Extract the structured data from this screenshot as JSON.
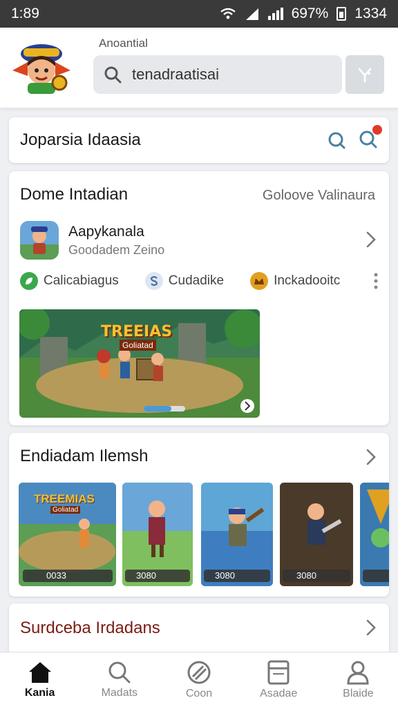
{
  "status": {
    "time": "1:89",
    "battery": "697%",
    "clock": "1334"
  },
  "header": {
    "label": "Anoantial",
    "search_value": "tenadraatisai"
  },
  "bar": {
    "title": "Joparsia Idaasia"
  },
  "featured": {
    "title": "Dome Intadian",
    "right_label": "Goloove Valinaura",
    "app": {
      "name": "Aapykanala",
      "subtitle": "Goodadem Zeino"
    },
    "tags": [
      {
        "label": "Calicabiagus",
        "icon": "leaf-icon",
        "color": "#3aa84a"
      },
      {
        "label": "Cudadike",
        "icon": "s-icon",
        "color": "#6a8fc0"
      },
      {
        "label": "Inckadooitc",
        "icon": "crown-icon",
        "color": "#e0a020"
      }
    ],
    "banner": {
      "title": "TREEIAS",
      "subtitle": "Goliatad"
    }
  },
  "section2": {
    "title": "Endiadam Ilemsh",
    "thumbs": [
      {
        "title": "TREEMIAS",
        "subtitle": "Goliatad",
        "caption": "0033",
        "bg": "#5b9e54"
      },
      {
        "title": "",
        "subtitle": "",
        "caption": "3080",
        "bg": "#7fbf5f"
      },
      {
        "title": "",
        "subtitle": "",
        "caption": "3080",
        "bg": "#5ea6d6"
      },
      {
        "title": "",
        "subtitle": "",
        "caption": "3080",
        "bg": "#6a4d3a"
      },
      {
        "title": "",
        "subtitle": "",
        "caption": "",
        "bg": "#4b8ac0"
      }
    ]
  },
  "section3": {
    "title": "Surdceba Irdadans"
  },
  "nav": [
    {
      "label": "Kania",
      "icon": "home-icon",
      "active": true
    },
    {
      "label": "Madats",
      "icon": "search-icon",
      "active": false
    },
    {
      "label": "Coon",
      "icon": "disc-icon",
      "active": false
    },
    {
      "label": "Asadae",
      "icon": "document-icon",
      "active": false
    },
    {
      "label": "Blaide",
      "icon": "profile-icon",
      "active": false
    }
  ]
}
